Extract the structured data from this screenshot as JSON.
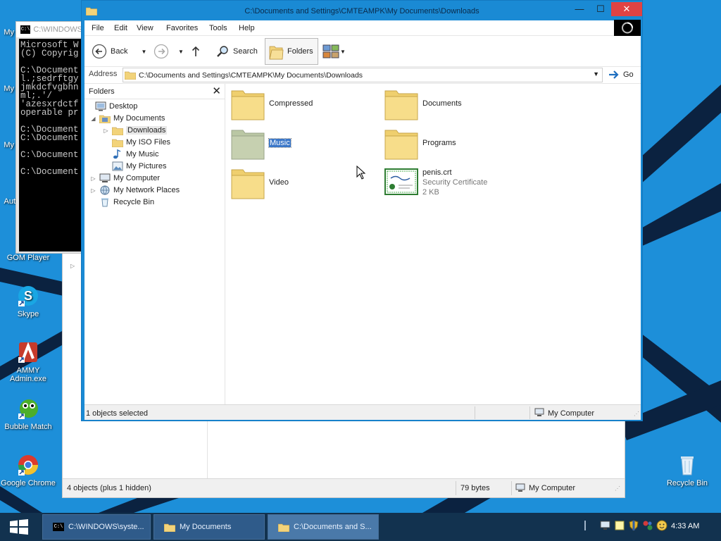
{
  "desktop": {
    "icons": {
      "gom": "GOM Player",
      "skype": "Skype",
      "ammy": "AMMY Admin.exe",
      "bubble": "Bubble Match",
      "chrome": "Google Chrome",
      "recycle": "Recycle Bin"
    },
    "edge_labels": [
      "My",
      "My",
      "My",
      "Aut"
    ]
  },
  "console": {
    "title": "C:\\WINDOWS",
    "lines": [
      "Microsoft W",
      "(C) Copyrig",
      "",
      "C:\\Document",
      "l.;sedrftgy",
      "jmkdcfvgbhn",
      "ml;.'/",
      "'azesxrdctf",
      "operable pr",
      "",
      "C:\\Document",
      "C:\\Document",
      "",
      "C:\\Document",
      "",
      "C:\\Document"
    ]
  },
  "main_window": {
    "title": "C:\\Documents and Settings\\CMTEAMPK\\My Documents\\Downloads",
    "menu": [
      "File",
      "Edit",
      "View",
      "Favorites",
      "Tools",
      "Help"
    ],
    "toolbar": {
      "back": "Back",
      "search": "Search",
      "folders": "Folders"
    },
    "address": {
      "label": "Address",
      "value": "C:\\Documents and Settings\\CMTEAMPK\\My Documents\\Downloads",
      "go": "Go"
    },
    "tree": {
      "header": "Folders",
      "nodes": [
        "Desktop",
        "My Documents",
        "Downloads",
        "My ISO Files",
        "My Music",
        "My Pictures",
        "My Computer",
        "My Network Places",
        "Recycle Bin"
      ]
    },
    "items": {
      "compressed": "Compressed",
      "documents": "Documents",
      "music": "Music",
      "programs": "Programs",
      "video": "Video",
      "cert_name": "penis.crt",
      "cert_type": "Security Certificate",
      "cert_size": "2 KB"
    },
    "status": {
      "left": "1 objects selected",
      "right": "My Computer"
    }
  },
  "bg_window": {
    "status": {
      "left": "4 objects (plus 1 hidden)",
      "size": "79 bytes",
      "right": "My Computer"
    }
  },
  "taskbar": {
    "tasks": [
      "C:\\WINDOWS\\syste...",
      "My Documents",
      "C:\\Documents and S..."
    ],
    "clock": "4:33 AM"
  },
  "colors": {
    "desktop": "#1d8fd9",
    "titlebar": "#1a8ad4",
    "close": "#e04343",
    "taskbar": "#12324f",
    "selection": "#3b77c8"
  }
}
